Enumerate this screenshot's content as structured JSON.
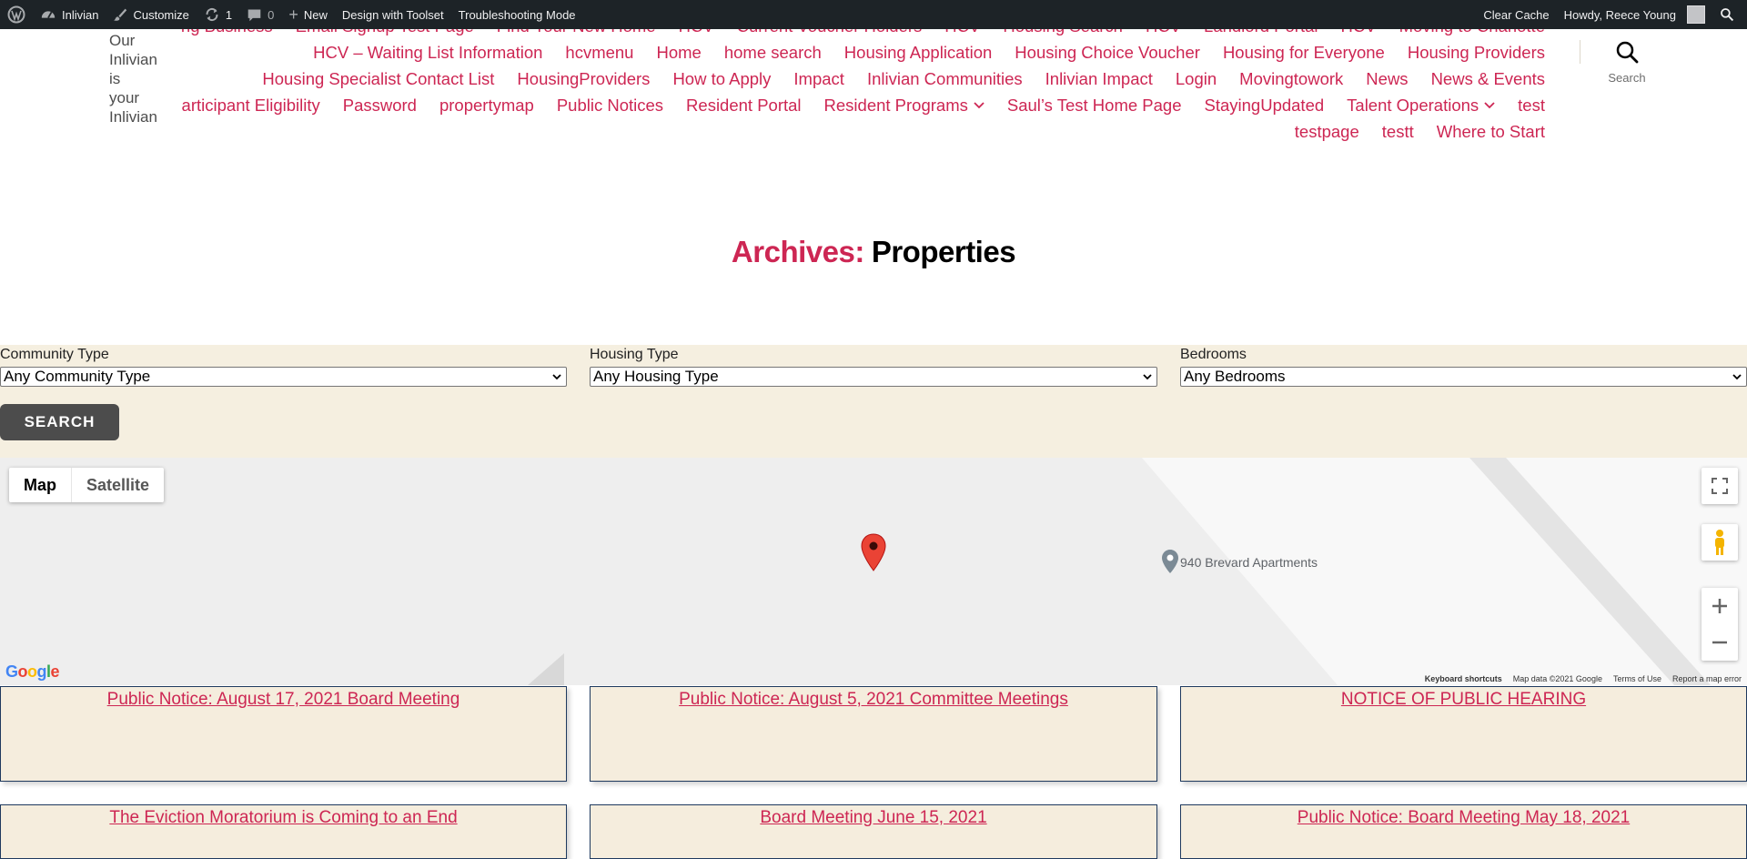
{
  "admin_bar": {
    "site_name": "Inlivian",
    "customize": "Customize",
    "updates_count": "1",
    "comments_count": "0",
    "new": "New",
    "toolset": "Design with Toolset",
    "troubleshooting": "Troubleshooting Mode",
    "clear_cache": "Clear Cache",
    "howdy": "Howdy, Reece Young"
  },
  "site": {
    "title_lines": [
      "Our",
      "Inlivian",
      "is",
      "your",
      "Inlivian"
    ]
  },
  "nav": {
    "items": [
      "Doing Business",
      "Email Signup Test Page",
      "Find Your New Home",
      "HCV",
      "Current Voucher Holders",
      "HCV",
      "Housing Search",
      "HCV",
      "Landlord Portal",
      "HCV",
      "Moving to Charlotte",
      "HCV – Waiting List Information",
      "hcvmenu",
      "Home",
      "home search",
      "Housing Application",
      "Housing Choice Voucher",
      "Housing for Everyone",
      "Housing Providers",
      "Housing Specialist Contact List",
      "HousingProviders",
      "How to Apply",
      "Impact",
      "Inlivian Communities",
      "Inlivian Impact",
      "Login",
      "Movingtowork",
      "News",
      "News & Events",
      "Participant Eligibility",
      "Password",
      "propertymap",
      "Public Notices",
      "Resident Portal",
      "Resident Programs",
      "Saul’s Test Home Page",
      "StayingUpdated",
      "Talent Operations",
      "test",
      "testpage",
      "testt",
      "Where to Start"
    ],
    "search_label": "Search"
  },
  "archive": {
    "prefix": "Archives:",
    "title": "Properties"
  },
  "filter": {
    "community_label": "Community Type",
    "community_value": "Any Community Type",
    "housing_label": "Housing Type",
    "housing_value": "Any Housing Type",
    "bedrooms_label": "Bedrooms",
    "bedrooms_value": "Any Bedrooms",
    "search_button": "SEARCH"
  },
  "map": {
    "map_button": "Map",
    "satellite_button": "Satellite",
    "poi_label": "940 Brevard Apartments",
    "logo": "Google",
    "keyboard_shortcuts": "Keyboard shortcuts",
    "map_data": "Map data ©2021 Google",
    "terms": "Terms of Use",
    "report": "Report a map error"
  },
  "cards": [
    "Public Notice: August 17, 2021 Board Meeting",
    "Public Notice: August 5, 2021 Committee Meetings",
    "NOTICE OF PUBLIC HEARING",
    "The Eviction Moratorium is Coming to an End",
    "Board Meeting June 15, 2021",
    "Public Notice: Board Meeting May 18, 2021"
  ]
}
